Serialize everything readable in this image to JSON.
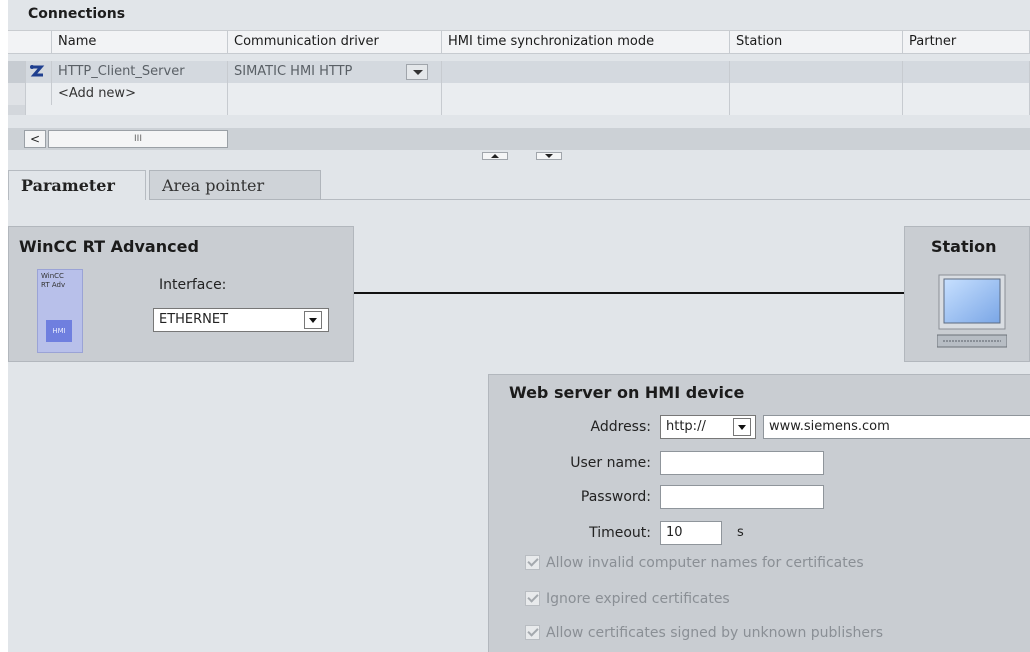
{
  "connections": {
    "section_title": "Connections",
    "columns": [
      "Name",
      "Communication driver",
      "HMI time synchronization mode",
      "Station",
      "Partner"
    ],
    "rows": [
      {
        "name": "HTTP_Client_Server",
        "driver": "SIMATIC HMI HTTP",
        "icon": "connection-icon"
      }
    ],
    "add_new_label": "<Add new>",
    "scroll_left_glyph": "<",
    "scroll_thumb_glyph": "III"
  },
  "tabs": [
    {
      "label": "Parameter",
      "active": true
    },
    {
      "label": "Area pointer",
      "active": false
    }
  ],
  "wincc_panel": {
    "title": "WinCC RT Advanced",
    "device_line1": "WinCC",
    "device_line2": "RT Adv",
    "device_badge": "HMI",
    "interface_label": "Interface:",
    "interface_value": "ETHERNET"
  },
  "station_panel": {
    "title": "Station",
    "icon": "monitor-icon"
  },
  "web_server": {
    "title": "Web server on HMI device",
    "address_label": "Address:",
    "protocol_value": "http://",
    "address_value": "www.siemens.com",
    "username_label": "User name:",
    "username_value": "",
    "password_label": "Password:",
    "password_value": "",
    "timeout_label": "Timeout:",
    "timeout_value": "10",
    "timeout_unit": "s",
    "checkboxes": [
      {
        "label": "Allow invalid computer names for certificates",
        "checked": true
      },
      {
        "label": "Ignore expired certificates",
        "checked": true
      },
      {
        "label": "Allow certificates signed by unknown publishers",
        "checked": true
      }
    ]
  },
  "colors": {
    "background": "#e1e5e9",
    "panel": "#c9cdd2",
    "hmi_badge": "#6f7fdf"
  }
}
